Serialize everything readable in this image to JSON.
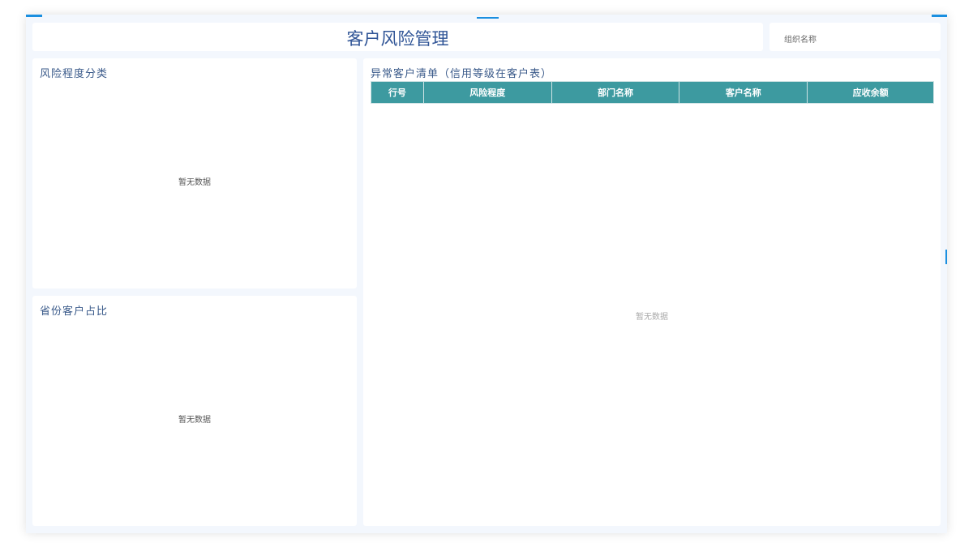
{
  "header": {
    "title": "客户风险管理",
    "org_placeholder": "组织名称"
  },
  "panels": {
    "risk_level": {
      "title": "风险程度分类",
      "empty": "暂无数据"
    },
    "province": {
      "title": "省份客户占比",
      "empty": "暂无数据"
    },
    "abnormal": {
      "title": "异常客户清单（信用等级在客户表）",
      "columns": [
        "行号",
        "风险程度",
        "部门名称",
        "客户名称",
        "应收余额"
      ],
      "empty": "暂无数据"
    }
  },
  "colors": {
    "accent": "#1a8fe0",
    "table_header": "#3d9aa0",
    "title": "#2f5496"
  }
}
